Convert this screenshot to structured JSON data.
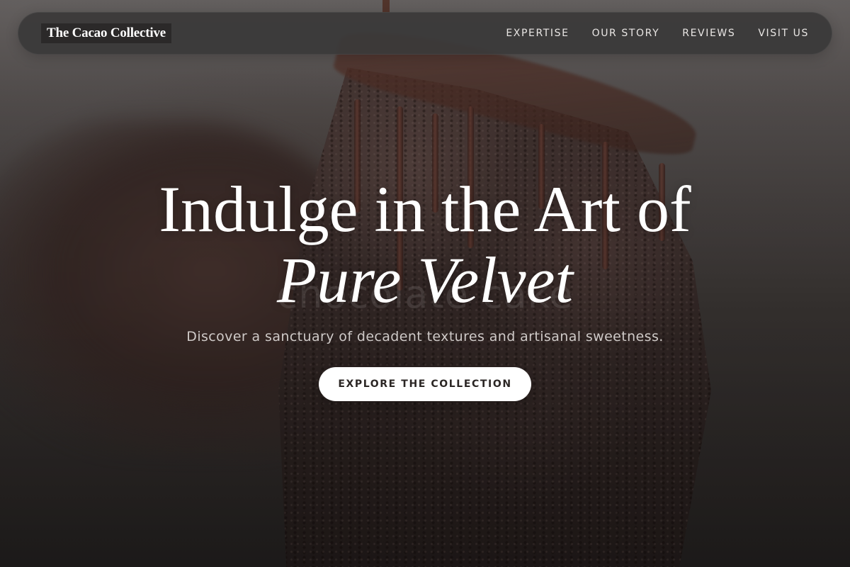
{
  "brand": {
    "name": "The Cacao Collective"
  },
  "nav": {
    "links": [
      {
        "label": "EXPERTISE"
      },
      {
        "label": "OUR STORY"
      },
      {
        "label": "REVIEWS"
      },
      {
        "label": "VISIT US"
      }
    ]
  },
  "hero": {
    "headline_line1": "Indulge in the Art of",
    "headline_line2": "Pure Velvet",
    "background_word": "chocolate cake",
    "subtitle": "Discover a sanctuary of decadent textures and artisanal sweetness.",
    "cta_label": "EXPLORE THE COLLECTION"
  },
  "colors": {
    "nav_background": "#3a3939",
    "text_primary": "#ffffff",
    "cta_background": "#ffffff",
    "cta_text": "#2b2624"
  }
}
